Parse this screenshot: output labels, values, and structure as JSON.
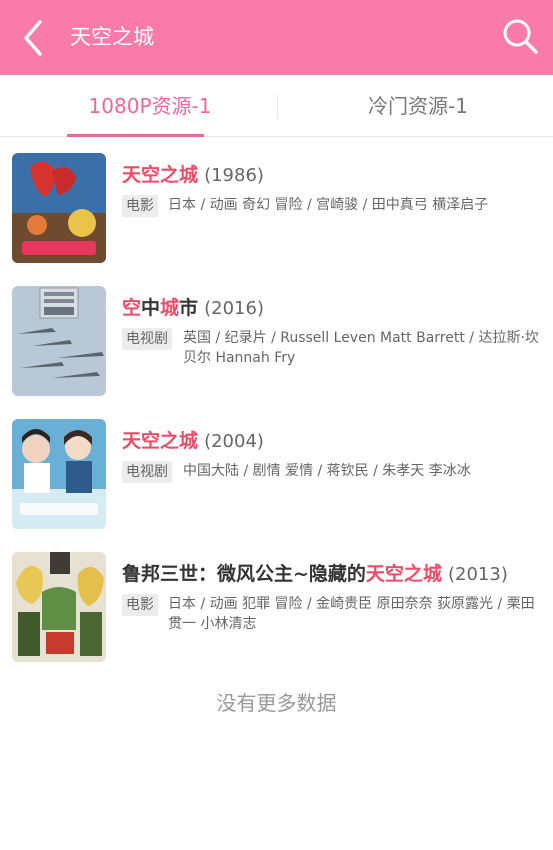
{
  "header": {
    "title": "天空之城",
    "back_icon": "back-chevron-icon",
    "search_icon": "search-icon",
    "bar_color": "#fb7ba8"
  },
  "tabs": [
    {
      "label": "1080P资源-1",
      "active": true
    },
    {
      "label": "冷门资源-1",
      "active": false
    }
  ],
  "results": [
    {
      "title_parts": [
        {
          "text": "天空之城",
          "hl": true
        }
      ],
      "year": "(1986)",
      "tag": "电影",
      "meta": "日本 / 动画 奇幻 冒险 / 宫崎骏 / 田中真弓 横泽启子"
    },
    {
      "title_parts": [
        {
          "text": "空",
          "hl": true
        },
        {
          "text": "中",
          "hl": false
        },
        {
          "text": "城",
          "hl": true
        },
        {
          "text": "市",
          "hl": false
        }
      ],
      "year": "(2016)",
      "tag": "电视剧",
      "meta": "英国 / 纪录片 / Russell Leven Matt Barrett / 达拉斯·坎贝尔 Hannah Fry"
    },
    {
      "title_parts": [
        {
          "text": "天空之城",
          "hl": true
        }
      ],
      "year": "(2004)",
      "tag": "电视剧",
      "meta": "中国大陆 / 剧情 爱情 / 蒋钦民 / 朱孝天 李冰冰"
    },
    {
      "title_parts": [
        {
          "text": "鲁邦三世：微风公主~隐藏的",
          "hl": false
        },
        {
          "text": "天空之城",
          "hl": true
        }
      ],
      "year": "(2013)",
      "tag": "电影",
      "meta": "日本 / 动画 犯罪 冒险 / 金崎贵臣 原田奈奈 荻原露光 / 栗田贯一 小林清志"
    }
  ],
  "footer": {
    "no_more": "没有更多数据"
  },
  "colors": {
    "accent": "#f0679a",
    "highlight": "#ee4b66"
  }
}
